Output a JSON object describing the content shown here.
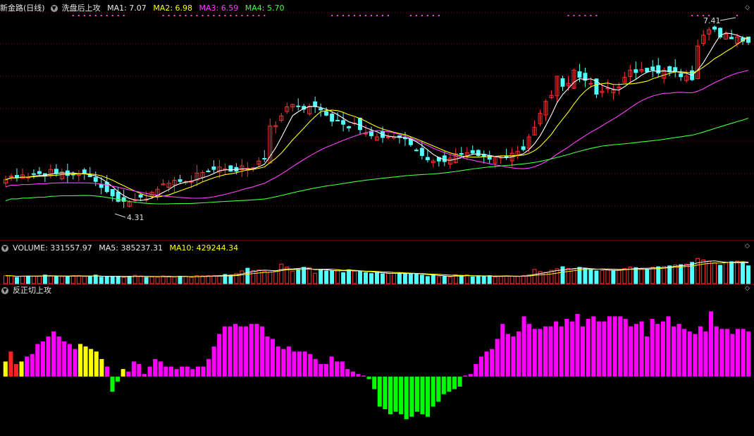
{
  "header_main": {
    "stock_name": "新金路(日线)",
    "indicator_name": "洗盘后上攻",
    "ma1": "MA1: 7.07",
    "ma2": "MA2: 6.98",
    "ma3": "MA3: 6.59",
    "ma4": "MA4: 5.70"
  },
  "header_volume": {
    "volume": "VOLUME: 331557.97",
    "ma5": "MA5: 385237.31",
    "ma10": "MA10: 429244.34"
  },
  "header_indicator": {
    "name": "反正切上攻"
  },
  "annotations": {
    "high_label": "7.41",
    "low_label": "4.31"
  },
  "colors": {
    "up": "#ff3232",
    "down": "#54ffff",
    "ma1": "#ffffff",
    "ma2": "#ffff00",
    "ma3": "#ff40ff",
    "ma4": "#40ff40",
    "grid": "#8b0000",
    "osc_magenta": "#ff00ff",
    "osc_yellow": "#ffff00",
    "osc_red": "#ff2020",
    "osc_green": "#00ff00",
    "signal_dot": "#ff40ff"
  },
  "chart_data": [
    {
      "type": "candlestick",
      "ylim": [
        3.9,
        7.65
      ],
      "close": [
        4.9,
        4.96,
        4.93,
        4.98,
        4.94,
        4.99,
        5.0,
        4.96,
        5.07,
        5.0,
        5.03,
        4.97,
        4.99,
        5.0,
        5.0,
        4.95,
        4.87,
        4.77,
        4.7,
        4.63,
        4.54,
        4.54,
        4.53,
        4.57,
        4.61,
        4.58,
        4.69,
        4.74,
        4.83,
        4.84,
        4.89,
        4.87,
        4.87,
        4.88,
        5.01,
        5.02,
        5.03,
        5.07,
        5.11,
        5.08,
        5.04,
        5.04,
        5.13,
        5.09,
        5.1,
        5.21,
        5.25,
        5.79,
        5.8,
        5.96,
        6.11,
        6.15,
        6.12,
        6.07,
        6.12,
        6.12,
        6.06,
        5.97,
        5.87,
        5.88,
        5.82,
        5.76,
        5.84,
        5.73,
        5.67,
        5.63,
        5.61,
        5.6,
        5.61,
        5.61,
        5.6,
        5.58,
        5.48,
        5.38,
        5.3,
        5.23,
        5.21,
        5.21,
        5.2,
        5.26,
        5.33,
        5.32,
        5.35,
        5.34,
        5.3,
        5.28,
        5.24,
        5.27,
        5.27,
        5.27,
        5.34,
        5.37,
        5.4,
        5.61,
        5.77,
        6.0,
        6.2,
        6.3,
        6.62,
        6.45,
        6.5,
        6.72,
        6.6,
        6.55,
        6.5,
        6.32,
        6.37,
        6.42,
        6.39,
        6.44,
        6.6,
        6.72,
        6.68,
        6.73,
        6.69,
        6.72,
        6.67,
        6.72,
        6.69,
        6.69,
        6.61,
        6.62,
        6.56,
        7.12,
        7.3,
        7.39,
        7.4,
        7.27,
        7.32,
        7.24,
        7.27,
        7.2,
        7.18
      ],
      "high_label": 7.41,
      "low_label": 4.31
    },
    {
      "type": "bar",
      "series": "VOLUME",
      "ylim": [
        0,
        1.0
      ],
      "values": [
        0.27,
        0.26,
        0.21,
        0.26,
        0.26,
        0.26,
        0.26,
        0.29,
        0.25,
        0.25,
        0.24,
        0.25,
        0.27,
        0.27,
        0.24,
        0.24,
        0.29,
        0.22,
        0.23,
        0.24,
        0.25,
        0.21,
        0.25,
        0.28,
        0.26,
        0.21,
        0.23,
        0.22,
        0.26,
        0.25,
        0.22,
        0.25,
        0.24,
        0.21,
        0.27,
        0.26,
        0.27,
        0.27,
        0.26,
        0.31,
        0.29,
        0.34,
        0.43,
        0.52,
        0.44,
        0.46,
        0.42,
        0.39,
        0.44,
        0.66,
        0.56,
        0.42,
        0.48,
        0.55,
        0.54,
        0.35,
        0.46,
        0.43,
        0.44,
        0.47,
        0.37,
        0.47,
        0.42,
        0.41,
        0.37,
        0.34,
        0.38,
        0.33,
        0.34,
        0.35,
        0.35,
        0.35,
        0.32,
        0.33,
        0.29,
        0.24,
        0.3,
        0.24,
        0.24,
        0.22,
        0.3,
        0.28,
        0.3,
        0.23,
        0.24,
        0.26,
        0.27,
        0.23,
        0.24,
        0.26,
        0.25,
        0.25,
        0.27,
        0.3,
        0.48,
        0.41,
        0.38,
        0.45,
        0.5,
        0.57,
        0.51,
        0.49,
        0.55,
        0.51,
        0.47,
        0.43,
        0.44,
        0.46,
        0.45,
        0.47,
        0.51,
        0.56,
        0.54,
        0.5,
        0.49,
        0.55,
        0.57,
        0.58,
        0.6,
        0.63,
        0.64,
        0.66,
        0.72,
        0.85,
        0.8,
        0.76,
        0.7,
        0.62,
        0.72,
        0.74,
        0.76,
        0.72,
        0.6
      ],
      "ma5_last": 385237.31,
      "ma10_last": 429244.34,
      "volume_last": 331557.97
    },
    {
      "type": "bar",
      "series": "反正切上攻",
      "ylim": [
        -1.1,
        1.6
      ],
      "values": [
        0.3,
        0.5,
        0.25,
        0.3,
        0.4,
        0.45,
        0.65,
        0.7,
        0.8,
        0.9,
        0.8,
        0.7,
        0.65,
        0.55,
        0.65,
        0.6,
        0.55,
        0.5,
        0.35,
        0.2,
        -0.3,
        -0.1,
        0.15,
        0.1,
        0.3,
        0.25,
        0.05,
        0.2,
        0.35,
        0.3,
        0.2,
        0.2,
        0.15,
        0.2,
        0.2,
        0.15,
        0.2,
        0.2,
        0.35,
        0.6,
        0.85,
        1.0,
        1.0,
        1.05,
        1.0,
        1.0,
        1.05,
        1.05,
        1.0,
        0.8,
        0.75,
        0.6,
        0.55,
        0.6,
        0.5,
        0.5,
        0.5,
        0.45,
        0.35,
        0.25,
        0.25,
        0.4,
        0.3,
        0.3,
        0.15,
        0.1,
        0.05,
        0.02,
        -0.05,
        -0.25,
        -0.6,
        -0.65,
        -0.75,
        -0.7,
        -0.75,
        -0.85,
        -0.8,
        -0.7,
        -0.75,
        -0.8,
        -0.6,
        -0.5,
        -0.35,
        -0.3,
        -0.25,
        -0.2,
        0.02,
        0.05,
        0.25,
        0.4,
        0.5,
        0.55,
        0.75,
        1.05,
        0.85,
        0.8,
        0.9,
        1.2,
        1.05,
        0.95,
        0.95,
        1.0,
        1.0,
        1.1,
        1.0,
        1.15,
        1.1,
        1.25,
        1.0,
        1.15,
        1.2,
        1.1,
        1.1,
        1.2,
        1.2,
        1.2,
        1.15,
        1.0,
        1.05,
        1.1,
        0.8,
        1.15,
        1.05,
        1.1,
        1.2,
        1.0,
        1.05,
        0.95,
        0.9,
        0.85,
        1.0,
        0.9,
        1.3,
        1.0,
        0.95,
        0.95,
        0.85,
        0.95,
        0.95,
        0.9
      ],
      "color_rule": "yellow/red in early and mid positive segments, magenta otherwise positive, green when negative"
    }
  ]
}
